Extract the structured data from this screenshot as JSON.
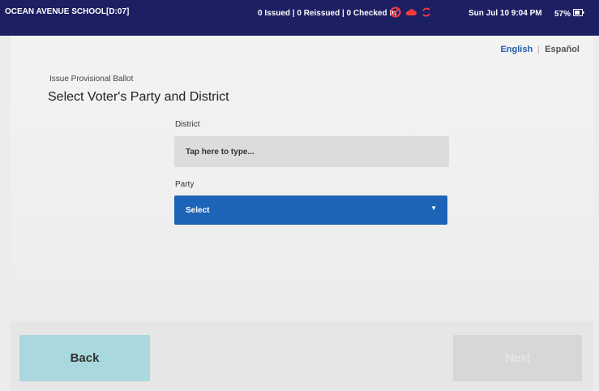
{
  "status_bar": {
    "location": "OCEAN AVENUE SCHOOL[D:07]",
    "counts": "0 Issued | 0 Reissued | 0 Checked In",
    "datetime": "Sun Jul 10  9:04 PM",
    "battery": "57%",
    "icons": [
      "no-connection-icon",
      "cloud-alert-icon",
      "sync-icon",
      "battery-icon"
    ]
  },
  "language": {
    "english": "English",
    "spanish": "Español"
  },
  "page": {
    "kicker": "Issue Provisional Ballot",
    "title": "Select Voter's Party and District"
  },
  "form": {
    "district_label": "District",
    "district_placeholder": "Tap here to type...",
    "party_label": "Party",
    "party_value": "Select"
  },
  "footer": {
    "back_label": "Back",
    "next_label": "Next"
  },
  "colors": {
    "topbar": "#1d1f63",
    "select_blue": "#1c64b7",
    "back_button": "#a9d8de",
    "language_active": "#1f5faa"
  }
}
